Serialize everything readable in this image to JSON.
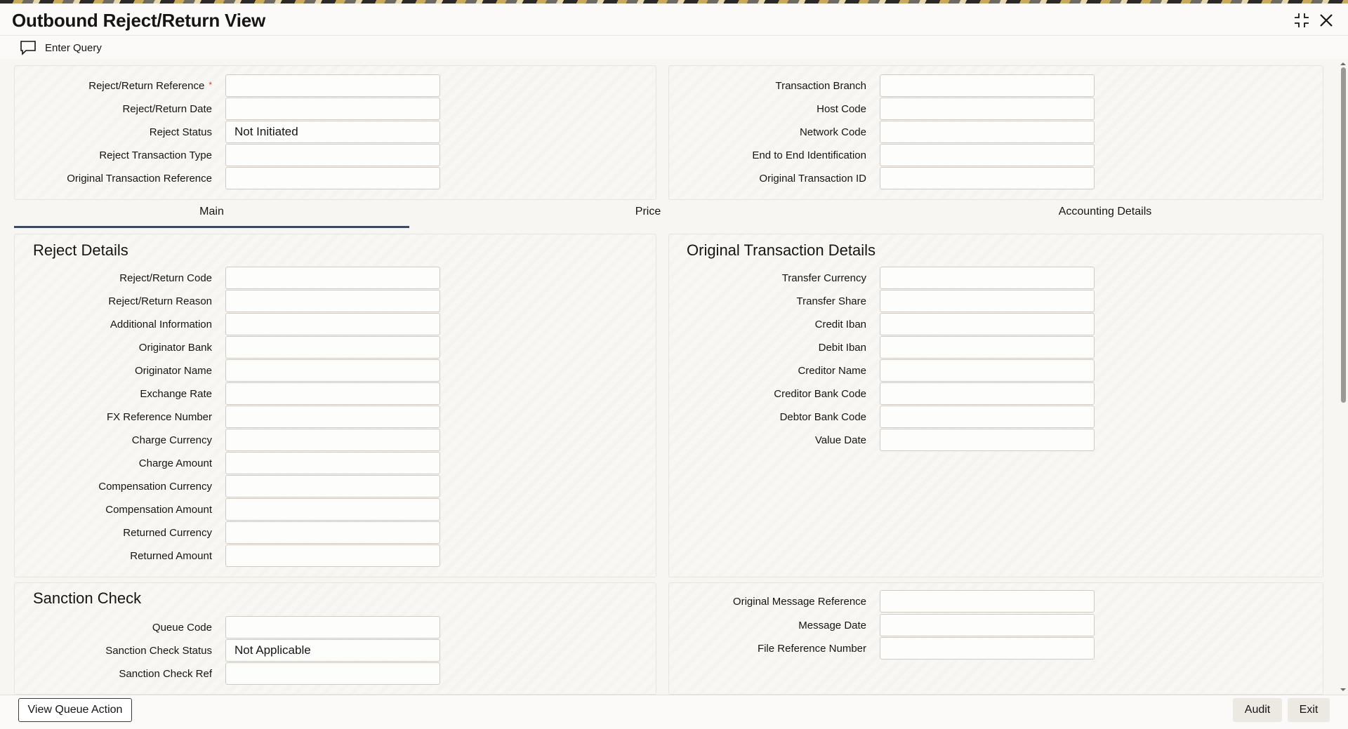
{
  "window": {
    "title": "Outbound Reject/Return View"
  },
  "toolbar": {
    "enter_query_label": "Enter Query"
  },
  "header_left": {
    "fields": [
      {
        "label": "Reject/Return Reference",
        "value": "",
        "required_mark": "*"
      },
      {
        "label": "Reject/Return Date",
        "value": ""
      },
      {
        "label": "Reject Status",
        "value": "Not Initiated"
      },
      {
        "label": "Reject Transaction Type",
        "value": ""
      },
      {
        "label": "Original Transaction Reference",
        "value": ""
      }
    ]
  },
  "header_right": {
    "fields": [
      {
        "label": "Transaction Branch",
        "value": ""
      },
      {
        "label": "Host Code",
        "value": ""
      },
      {
        "label": "Network Code",
        "value": ""
      },
      {
        "label": "End to End Identification",
        "value": ""
      },
      {
        "label": "Original Transaction ID",
        "value": ""
      }
    ]
  },
  "tabs": [
    {
      "label": "Main",
      "active": true
    },
    {
      "label": "Price",
      "active": false
    },
    {
      "label": "Accounting Details",
      "active": false
    }
  ],
  "reject_details": {
    "title": "Reject Details",
    "fields": [
      {
        "label": "Reject/Return Code",
        "value": ""
      },
      {
        "label": "Reject/Return Reason",
        "value": ""
      },
      {
        "label": "Additional Information",
        "value": ""
      },
      {
        "label": "Originator Bank",
        "value": ""
      },
      {
        "label": "Originator Name",
        "value": ""
      },
      {
        "label": "Exchange Rate",
        "value": ""
      },
      {
        "label": "FX Reference Number",
        "value": ""
      },
      {
        "label": "Charge Currency",
        "value": ""
      },
      {
        "label": "Charge Amount",
        "value": ""
      },
      {
        "label": "Compensation Currency",
        "value": ""
      },
      {
        "label": "Compensation Amount",
        "value": ""
      },
      {
        "label": "Returned Currency",
        "value": ""
      },
      {
        "label": "Returned Amount",
        "value": ""
      }
    ]
  },
  "original_transaction_details": {
    "title": "Original Transaction Details",
    "fields": [
      {
        "label": "Transfer Currency",
        "value": ""
      },
      {
        "label": "Transfer Share",
        "value": ""
      },
      {
        "label": "Credit Iban",
        "value": ""
      },
      {
        "label": "Debit Iban",
        "value": ""
      },
      {
        "label": "Creditor Name",
        "value": ""
      },
      {
        "label": "Creditor Bank Code",
        "value": ""
      },
      {
        "label": "Debtor Bank Code",
        "value": ""
      },
      {
        "label": "Value Date",
        "value": ""
      }
    ]
  },
  "sanction_check": {
    "title": "Sanction Check",
    "fields": [
      {
        "label": "Queue Code",
        "value": ""
      },
      {
        "label": "Sanction Check Status",
        "value": "Not Applicable"
      },
      {
        "label": "Sanction Check Ref",
        "value": ""
      }
    ]
  },
  "message_details": {
    "fields": [
      {
        "label": "Original Message Reference",
        "value": ""
      },
      {
        "label": "Message Date",
        "value": ""
      },
      {
        "label": "File Reference Number",
        "value": ""
      }
    ]
  },
  "footer": {
    "view_queue_action_label": "View Queue Action",
    "audit_label": "Audit",
    "exit_label": "Exit"
  },
  "icons": {
    "enter_query": "chat-bubble-icon",
    "expand": "expand-icon",
    "close": "close-icon"
  },
  "colors": {
    "required_marker": "#c74634",
    "active_tab_underline": "#3c4a5f"
  }
}
